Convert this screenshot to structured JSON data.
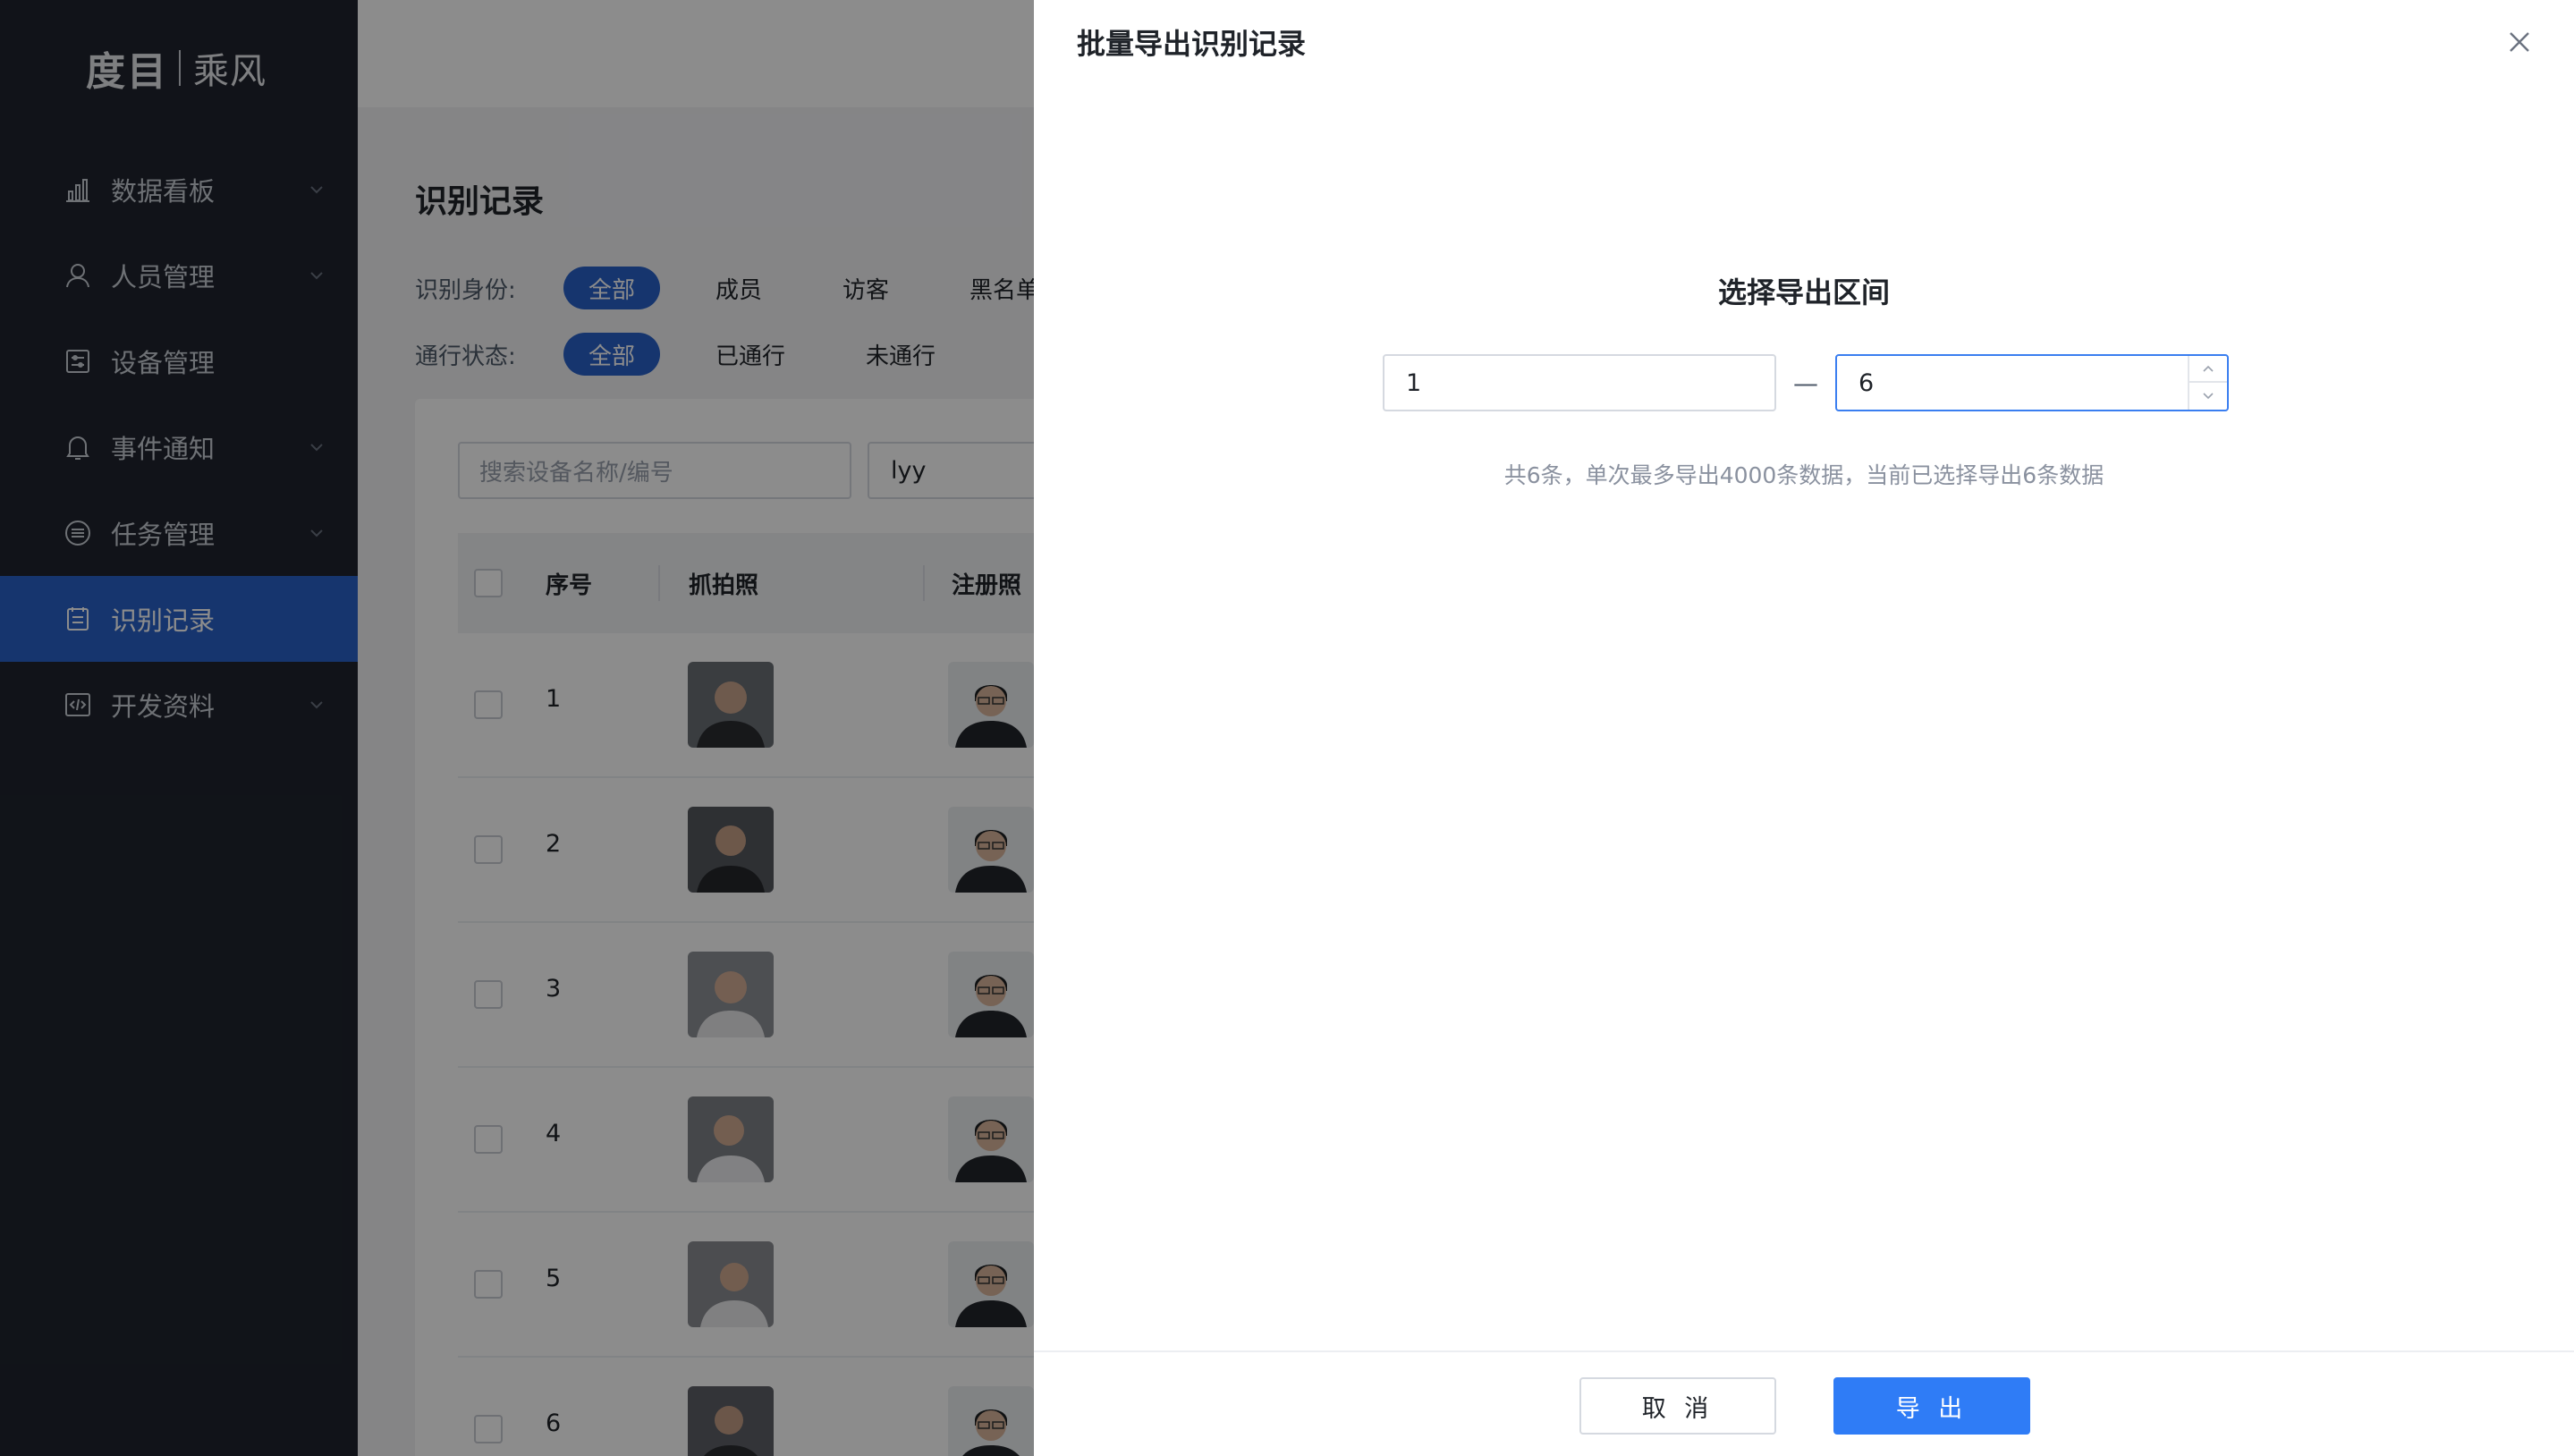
{
  "sidebar": {
    "logo_brand": "度目",
    "logo_product": "乘风",
    "items": [
      {
        "label": "数据看板",
        "icon": "bar-chart-icon",
        "has_children": true,
        "active": false
      },
      {
        "label": "人员管理",
        "icon": "user-icon",
        "has_children": true,
        "active": false
      },
      {
        "label": "设备管理",
        "icon": "device-icon",
        "has_children": false,
        "active": false
      },
      {
        "label": "事件通知",
        "icon": "bell-icon",
        "has_children": true,
        "active": false
      },
      {
        "label": "任务管理",
        "icon": "task-icon",
        "has_children": true,
        "active": false
      },
      {
        "label": "识别记录",
        "icon": "record-icon",
        "has_children": false,
        "active": true
      },
      {
        "label": "开发资料",
        "icon": "code-icon",
        "has_children": true,
        "active": false
      }
    ]
  },
  "page": {
    "title": "识别记录",
    "identity_filter": {
      "label": "识别身份:",
      "options": [
        "全部",
        "成员",
        "访客",
        "黑名单"
      ],
      "selected": "全部"
    },
    "pass_filter": {
      "label": "通行状态:",
      "options": [
        "全部",
        "已通行",
        "未通行"
      ],
      "selected": "全部"
    },
    "search_placeholder": "搜索设备名称/编号",
    "search2_value": "lyy",
    "table": {
      "headers": [
        "序号",
        "抓拍照",
        "注册照"
      ],
      "rows": [
        "1",
        "2",
        "3",
        "4",
        "5",
        "6"
      ]
    }
  },
  "drawer": {
    "title": "批量导出识别记录",
    "section_title": "选择导出区间",
    "range_from": "1",
    "range_separator": "—",
    "range_to": "6",
    "hint": "共6条，单次最多导出4000条数据，当前已选择导出6条数据",
    "cancel_label": "取 消",
    "export_label": "导 出"
  },
  "colors": {
    "sidebar_bg": "#1f242e",
    "accent": "#2861c8",
    "primary_button": "#2f7cf6"
  }
}
